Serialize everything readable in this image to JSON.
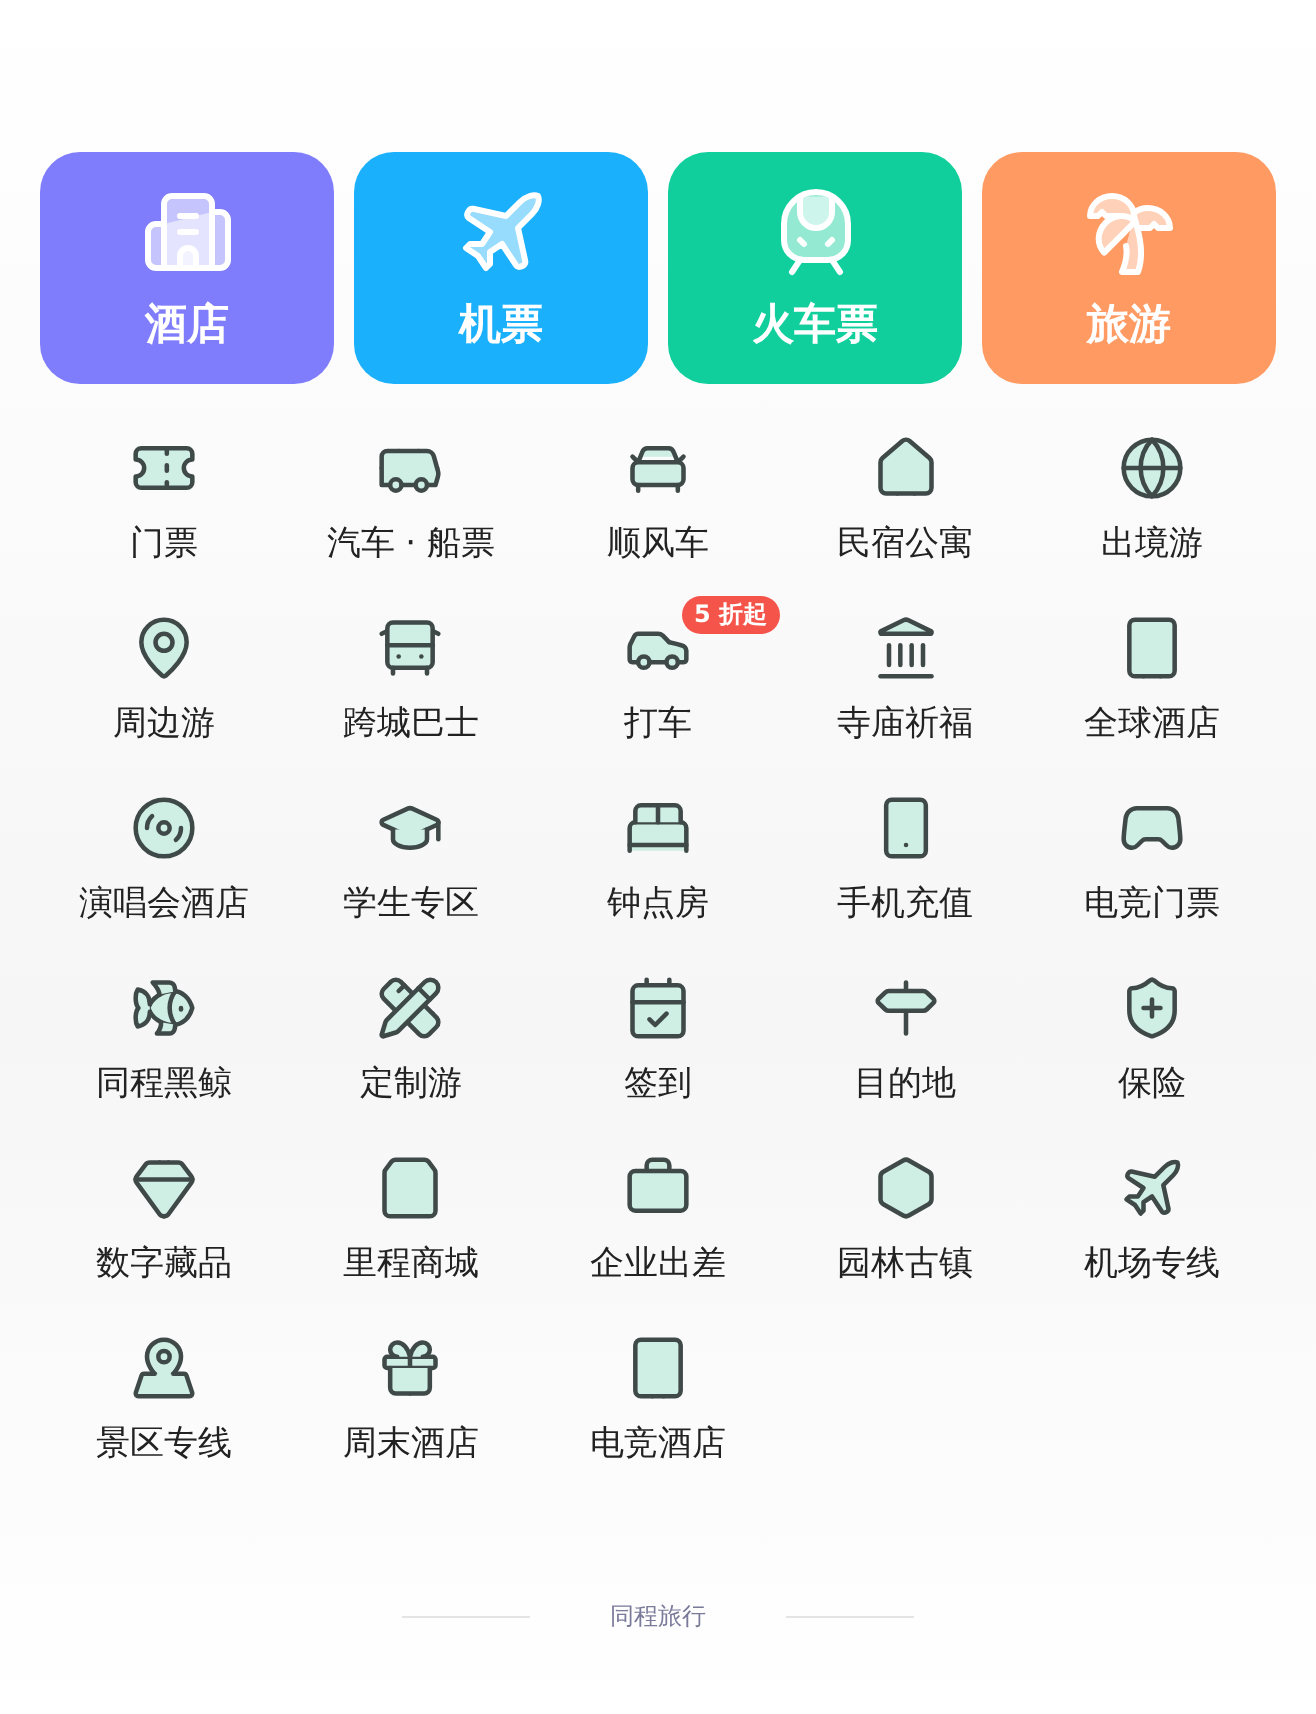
{
  "main_tiles": [
    {
      "label": "酒店",
      "color": "#7f7dfb"
    },
    {
      "label": "机票",
      "color": "#1ab0fb"
    },
    {
      "label": "火车票",
      "color": "#10cf9c"
    },
    {
      "label": "旅游",
      "color": "#fe9a62"
    }
  ],
  "services": [
    {
      "label": "门票"
    },
    {
      "label": "汽车 · 船票"
    },
    {
      "label": "顺风车"
    },
    {
      "label": "民宿公寓"
    },
    {
      "label": "出境游"
    },
    {
      "label": "周边游"
    },
    {
      "label": "跨城巴士"
    },
    {
      "label": "打车",
      "badge": "5 折起"
    },
    {
      "label": "寺庙祈福"
    },
    {
      "label": "全球酒店"
    },
    {
      "label": "演唱会酒店"
    },
    {
      "label": "学生专区"
    },
    {
      "label": "钟点房"
    },
    {
      "label": "手机充值"
    },
    {
      "label": "电竞门票"
    },
    {
      "label": "同程黑鲸"
    },
    {
      "label": "定制游"
    },
    {
      "label": "签到"
    },
    {
      "label": "目的地"
    },
    {
      "label": "保险"
    },
    {
      "label": "数字藏品"
    },
    {
      "label": "里程商城"
    },
    {
      "label": "企业出差"
    },
    {
      "label": "园林古镇"
    },
    {
      "label": "机场专线"
    },
    {
      "label": "景区专线"
    },
    {
      "label": "周末酒店"
    },
    {
      "label": "电竞酒店"
    }
  ],
  "footer": {
    "brand": "同程旅行"
  }
}
